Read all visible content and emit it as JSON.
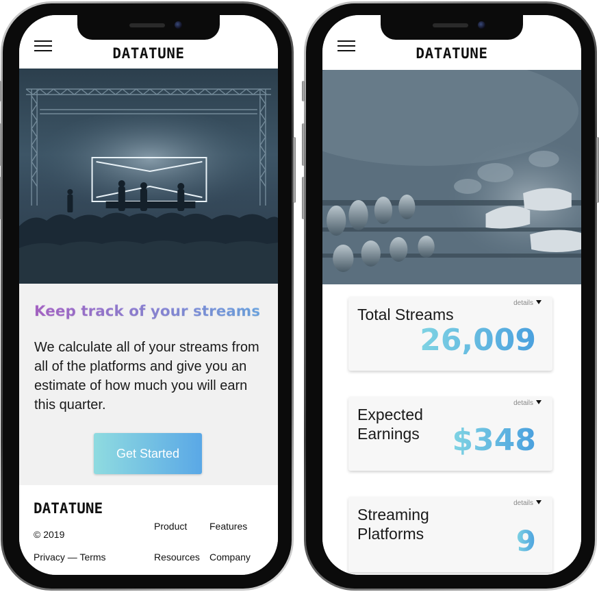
{
  "left_phone": {
    "header": {
      "brand": "DATATUNE"
    },
    "promo": {
      "title": "Keep track of your streams",
      "body": "We calculate all of your streams from all of the platforms and give you an estimate of how much you will earn this quarter.",
      "cta_label": "Get Started"
    },
    "footer": {
      "brand": "DATATUNE",
      "copyright": "© 2019",
      "privacy": "Privacy",
      "separator": " — ",
      "terms": "Terms",
      "links": {
        "product": "Product",
        "features": "Features",
        "resources": "Resources",
        "company": "Company"
      }
    }
  },
  "right_phone": {
    "header": {
      "brand": "DATATUNE"
    },
    "cards": [
      {
        "label": "Total Streams",
        "value": "26,009",
        "details": "details"
      },
      {
        "label": "Expected Earnings",
        "value": "$348",
        "details": "details"
      },
      {
        "label": "Streaming Platforms",
        "value": "9",
        "details": "details"
      }
    ]
  },
  "colors": {
    "title_gradient_start": "#b06bd0",
    "title_gradient_end": "#6fb0ec",
    "accent_gradient_start": "#8fdbe0",
    "accent_gradient_end": "#4aa0de",
    "promo_background": "#f1f1f1"
  },
  "icons": {
    "menu": "hamburger-menu-icon",
    "details_caret": "caret-down-icon"
  }
}
